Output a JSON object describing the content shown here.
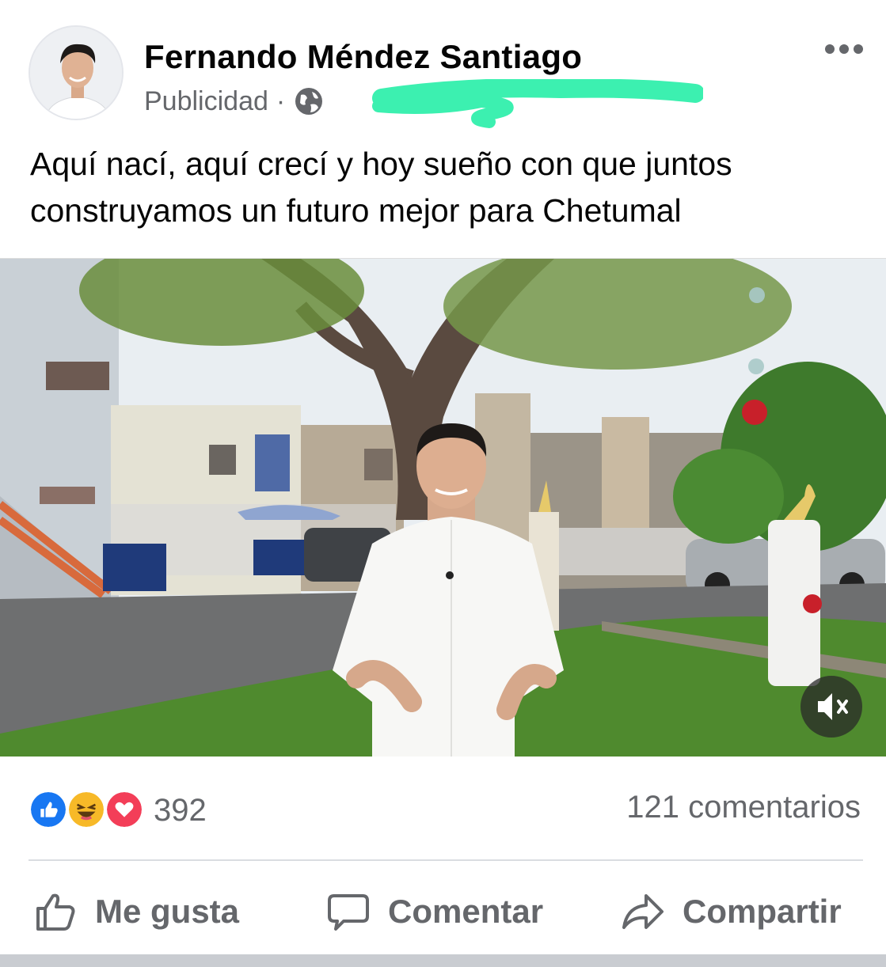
{
  "post": {
    "author": "Fernando Méndez Santiago",
    "sponsored_label": "Publicidad",
    "separator": "·",
    "audience_icon": "globe-icon",
    "caption": "Aquí nací, aquí crecí y hoy sueño con que juntos construyamos un futuro mejor para Chetumal"
  },
  "video": {
    "muted": true,
    "mute_icon": "speaker-muted-icon"
  },
  "stats": {
    "reactions": [
      "like",
      "haha",
      "love"
    ],
    "reaction_count": "392",
    "comment_count": "121 comentarios"
  },
  "actions": {
    "like": "Me gusta",
    "comment": "Comentar",
    "share": "Compartir"
  },
  "colors": {
    "like_blue": "#1877f2",
    "love_red": "#f33e58",
    "haha_yellow": "#f7b928",
    "secondary_text": "#65676b",
    "scribble": "#3cf0b0"
  }
}
